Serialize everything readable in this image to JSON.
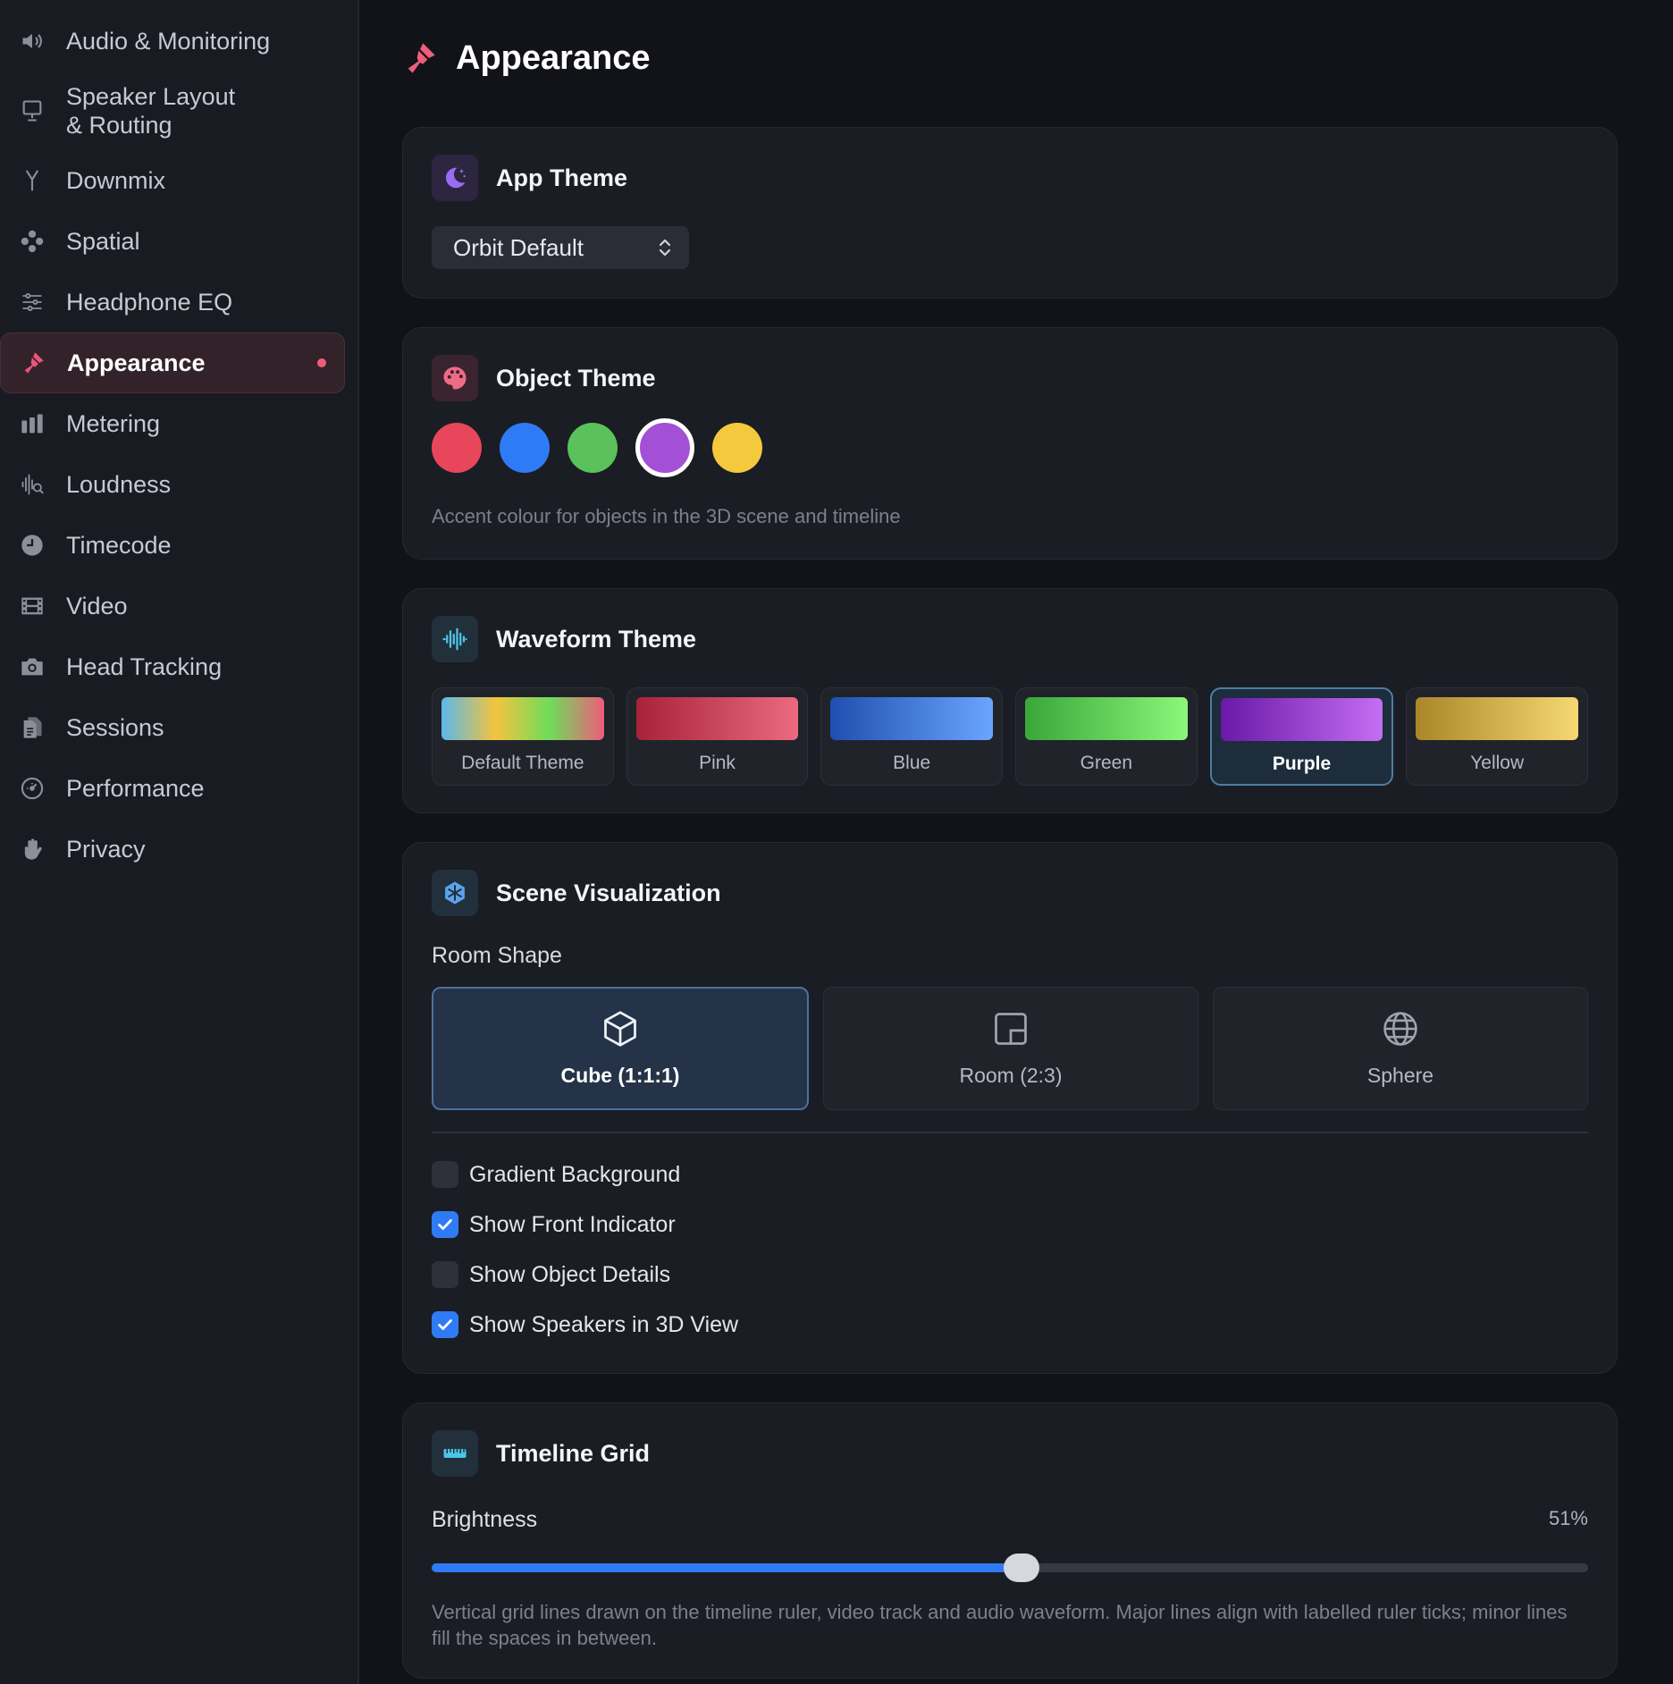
{
  "sidebar": {
    "items": [
      {
        "label": "Audio & Monitoring",
        "icon": "speaker-icon"
      },
      {
        "label": "Speaker Layout\n& Routing",
        "icon": "monitor-icon"
      },
      {
        "label": "Downmix",
        "icon": "merge-icon"
      },
      {
        "label": "Spatial",
        "icon": "spatial-dots-icon"
      },
      {
        "label": "Headphone EQ",
        "icon": "sliders-icon"
      },
      {
        "label": "Appearance",
        "icon": "paintbrush-icon",
        "active": true
      },
      {
        "label": "Metering",
        "icon": "meter-bars-icon"
      },
      {
        "label": "Loudness",
        "icon": "waveform-search-icon"
      },
      {
        "label": "Timecode",
        "icon": "clock-icon"
      },
      {
        "label": "Video",
        "icon": "film-icon"
      },
      {
        "label": "Head Tracking",
        "icon": "camera-icon"
      },
      {
        "label": "Sessions",
        "icon": "documents-icon"
      },
      {
        "label": "Performance",
        "icon": "gauge-icon"
      },
      {
        "label": "Privacy",
        "icon": "hand-icon"
      }
    ]
  },
  "page": {
    "title": "Appearance",
    "icon": "paintbrush-icon"
  },
  "app_theme": {
    "title": "App Theme",
    "icon": "moon-stars-icon",
    "selected": "Orbit Default"
  },
  "object_theme": {
    "title": "Object Theme",
    "icon": "palette-icon",
    "colors": [
      "#e8465a",
      "#2f7bf5",
      "#5bc15b",
      "#a450d6",
      "#f4c93d"
    ],
    "selected_index": 3,
    "hint": "Accent colour for objects in the 3D scene and timeline"
  },
  "waveform_theme": {
    "title": "Waveform Theme",
    "icon": "waveform-icon",
    "options": [
      {
        "label": "Default Theme",
        "gradient": "linear-gradient(90deg,#5bb8e8,#f3c43e,#6fdc5a,#ee5d7b)"
      },
      {
        "label": "Pink",
        "gradient": "linear-gradient(90deg,#a8223a,#ec6a80)"
      },
      {
        "label": "Blue",
        "gradient": "linear-gradient(90deg,#1f4fb0,#6aa5ff)"
      },
      {
        "label": "Green",
        "gradient": "linear-gradient(90deg,#3aa63a,#8bf77a)"
      },
      {
        "label": "Purple",
        "gradient": "linear-gradient(90deg,#6a18a8,#c46ef3)",
        "selected": true
      },
      {
        "label": "Yellow",
        "gradient": "linear-gradient(90deg,#a9872a,#f6d872)"
      }
    ]
  },
  "scene": {
    "title": "Scene Visualization",
    "icon": "snowflake-icon",
    "room_shape_label": "Room Shape",
    "rooms": [
      {
        "label": "Cube (1:1:1)",
        "icon": "cube-icon",
        "selected": true
      },
      {
        "label": "Room (2:3)",
        "icon": "room-icon"
      },
      {
        "label": "Sphere",
        "icon": "globe-icon"
      }
    ],
    "checks": [
      {
        "label": "Gradient Background",
        "checked": false
      },
      {
        "label": "Show Front Indicator",
        "checked": true
      },
      {
        "label": "Show Object Details",
        "checked": false
      },
      {
        "label": "Show Speakers in 3D View",
        "checked": true
      }
    ]
  },
  "timeline_grid": {
    "title": "Timeline Grid",
    "icon": "ruler-icon",
    "brightness_label": "Brightness",
    "brightness_value": 0.51,
    "brightness_text": "51%",
    "description": "Vertical grid lines drawn on the timeline ruler, video track and audio waveform. Major lines align with labelled ruler ticks; minor lines fill the spaces in between."
  }
}
